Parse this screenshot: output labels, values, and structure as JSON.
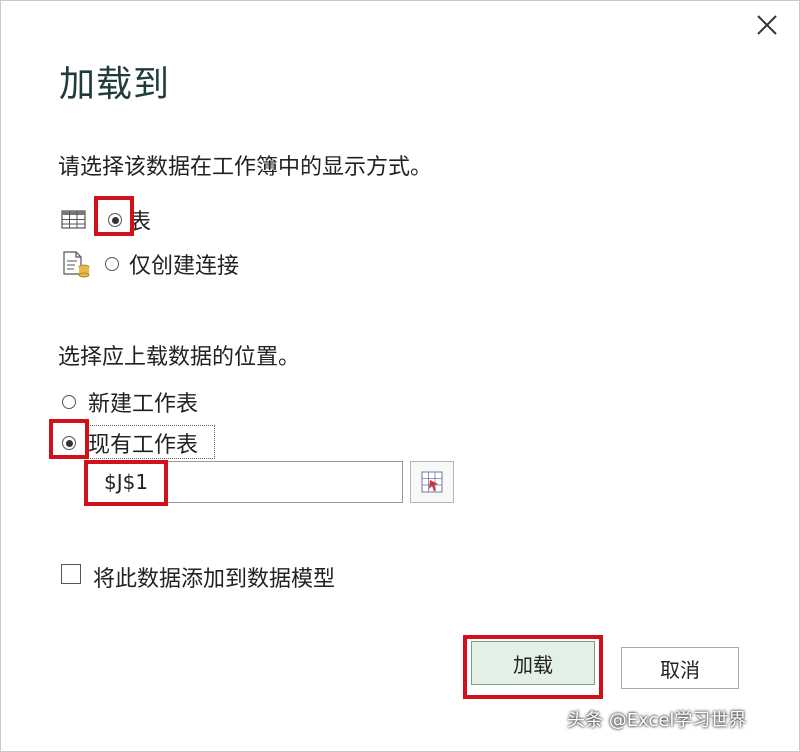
{
  "dialog": {
    "title": "加载到",
    "close_icon": "close-icon"
  },
  "display_section": {
    "label": "请选择该数据在工作簿中的显示方式。",
    "options": [
      {
        "label": "表",
        "icon": "table-icon",
        "selected": true
      },
      {
        "label": "仅创建连接",
        "icon": "connection-icon",
        "selected": false
      }
    ]
  },
  "location_section": {
    "label": "选择应上载数据的位置。",
    "options": [
      {
        "label": "新建工作表",
        "selected": false
      },
      {
        "label": "现有工作表",
        "selected": true
      }
    ],
    "reference_value": "$J$1",
    "range_picker_icon": "range-picker-icon"
  },
  "data_model": {
    "label": "将此数据添加到数据模型",
    "checked": false
  },
  "buttons": {
    "load": "加载",
    "cancel": "取消"
  },
  "watermark": "头条 @Excel学习世界",
  "colors": {
    "highlight": "#d0101b",
    "title": "#1f3b3b",
    "load_button_bg": "#e2f0e6"
  }
}
